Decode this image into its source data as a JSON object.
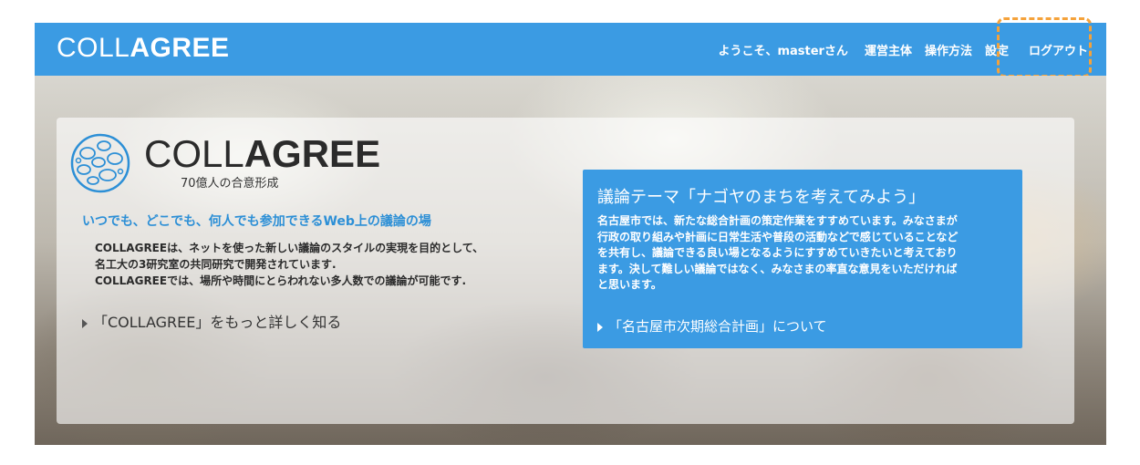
{
  "header": {
    "logo_thin": "COLL",
    "logo_bold": "AGREE",
    "nav": {
      "greeting": "ようこそ、masterさん",
      "operator": "運営主体",
      "howto": "操作方法",
      "settings": "設定",
      "logout": "ログアウト"
    }
  },
  "brand": {
    "name_thin": "COLL",
    "name_bold": "AGREE",
    "tagline": "70億人の合意形成"
  },
  "intro": {
    "lead": "いつでも、どこでも、何人でも参加できるWeb上の議論の場",
    "desc": [
      "COLLAGREEは、ネットを使った新しい議論のスタイルの実現を目的として、",
      "名工大の3研究室の共同研究で開発されています.",
      "COLLAGREEでは、場所や時間にとらわれない多人数での議論が可能です."
    ],
    "more_link": "「COLLAGREE」をもっと詳しく知る"
  },
  "theme": {
    "title": "議論テーマ「ナゴヤのまちを考えてみよう」",
    "body": [
      "名古屋市では、新たな総合計画の策定作業をすすめています。みなさまが",
      "行政の取り組みや計画に日常生活や普段の活動などで感じていることなど",
      "を共有し、議論できる良い場となるようにすすめていきたいと考えており",
      "ます。決して難しい議論ではなく、みなさまの率直な意見をいただければ",
      "と思います。"
    ],
    "link": "「名古屋市次期総合計画」について"
  },
  "colors": {
    "accent": "#3b9be3",
    "highlight": "#f5a23a",
    "lead_text": "#2c8fd6"
  }
}
